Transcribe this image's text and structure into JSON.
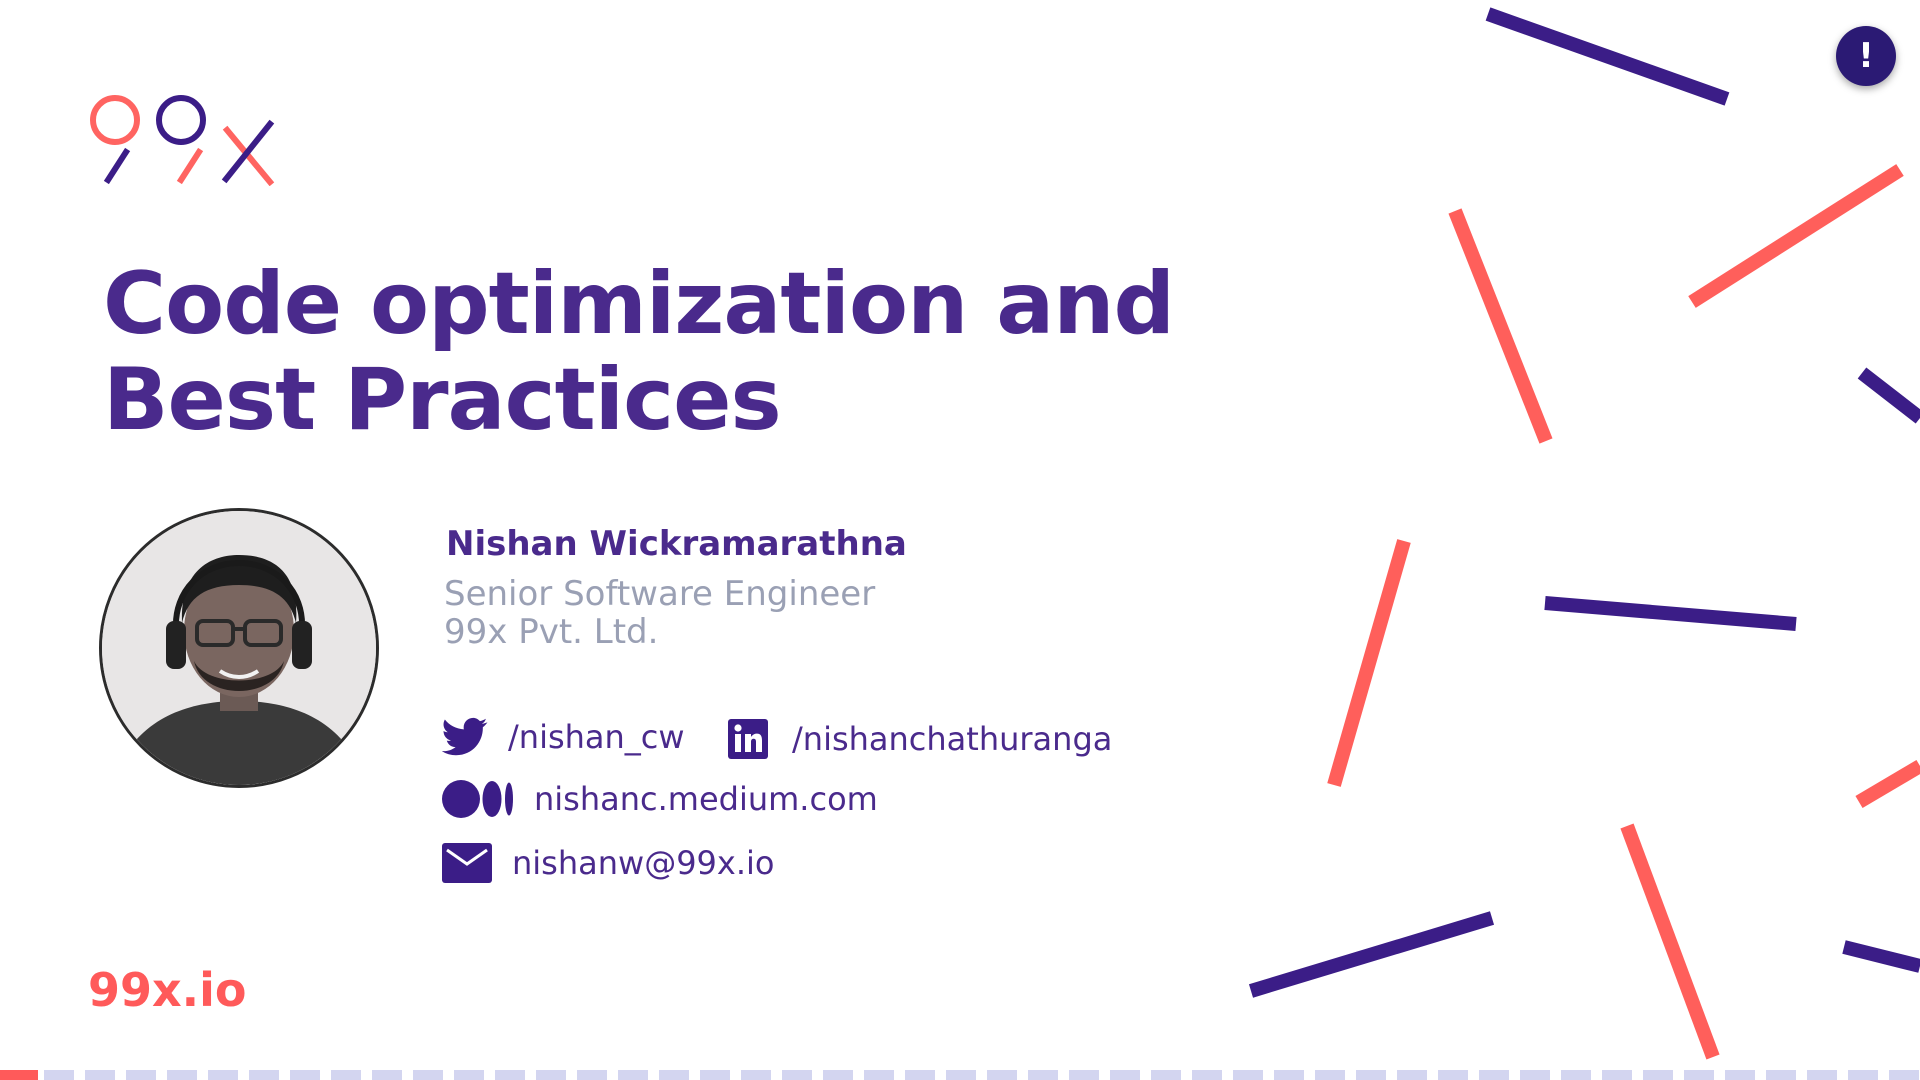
{
  "slide": {
    "title_line1": "Code optimization and",
    "title_line2": "Best Practices",
    "footer_site": "99x.io"
  },
  "speaker": {
    "name": "Nishan Wickramarathna",
    "role": "Senior Software Engineer",
    "company": "99x Pvt. Ltd."
  },
  "contacts": {
    "twitter": "/nishan_cw",
    "linkedin": "/nishanchathuranga",
    "medium": "nishanc.medium.com",
    "email": "nishanw@99x.io"
  },
  "logo": {
    "text": "99x"
  },
  "icons": {
    "twitter": "twitter-icon",
    "linkedin": "linkedin-icon",
    "medium": "medium-icon",
    "email": "mail-icon",
    "alert": "exclamation-icon"
  },
  "alert_button": {
    "label": "!"
  },
  "colors": {
    "primary": "#4a2a8c",
    "accent": "#ff5a5a",
    "muted_text": "#9aa0b4",
    "dark_button": "#2b1a74",
    "progress_dash": "#d3d5f0"
  },
  "progress": {
    "fraction": 0.02
  }
}
